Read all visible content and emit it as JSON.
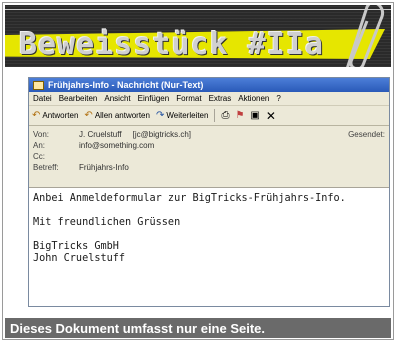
{
  "banner": {
    "title": "Beweisstück #IIa"
  },
  "window": {
    "title": "Frühjahrs-Info - Nachricht (Nur-Text)",
    "menu": [
      "Datei",
      "Bearbeiten",
      "Ansicht",
      "Einfügen",
      "Format",
      "Extras",
      "Aktionen",
      "?"
    ],
    "toolbar": {
      "reply": "Antworten",
      "reply_all": "Allen antworten",
      "forward": "Weiterleiten"
    },
    "headers": {
      "from_label": "Von:",
      "from_value": "J. Cruelstuff     [jc@bigtricks.ch]",
      "to_label": "An:",
      "to_value": "info@something.com",
      "cc_label": "Cc:",
      "cc_value": "",
      "subject_label": "Betreff:",
      "subject_value": "Frühjahrs-Info",
      "sent_label": "Gesendet:"
    },
    "body": {
      "line1": "Anbei Anmeldeformular zur BigTricks-Frühjahrs-Info.",
      "line2": "Mit freundlichen Grüssen",
      "line3": "BigTricks GmbH",
      "line4": "John Cruelstuff"
    }
  },
  "footer": {
    "text": "Dieses Dokument umfasst nur eine Seite."
  }
}
